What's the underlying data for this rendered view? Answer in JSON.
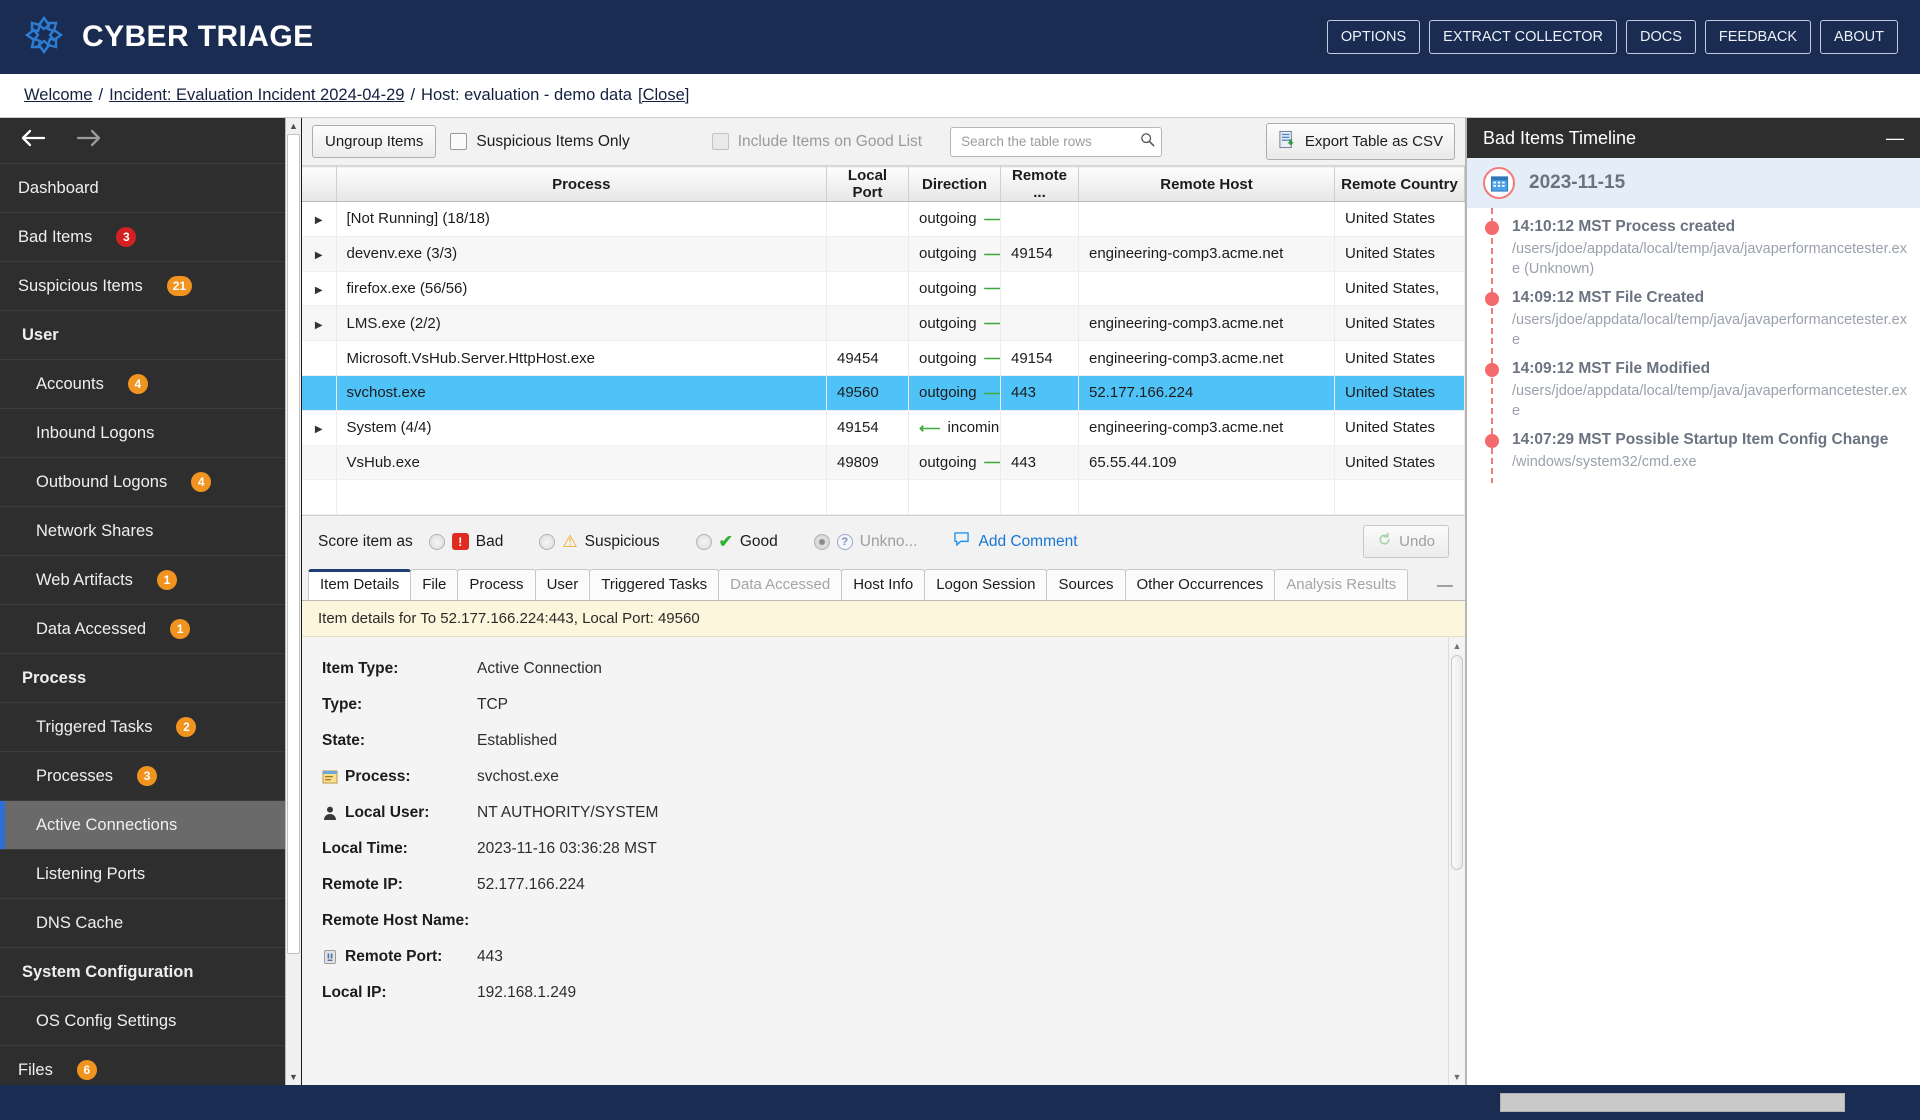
{
  "app": {
    "brand": "CYBER TRIAGE",
    "logo_icon": "cyber-triage-logo-icon",
    "top_buttons": [
      {
        "label": "OPTIONS",
        "name": "options-button"
      },
      {
        "label": "EXTRACT COLLECTOR",
        "name": "extract-collector-button"
      },
      {
        "label": "DOCS",
        "name": "docs-button"
      },
      {
        "label": "FEEDBACK",
        "name": "feedback-button"
      },
      {
        "label": "ABOUT",
        "name": "about-button"
      }
    ]
  },
  "breadcrumb": {
    "welcome": "Welcome",
    "sep1": "/",
    "incident": "Incident: Evaluation Incident 2024-04-29",
    "sep2": "/",
    "host": "Host: evaluation - demo data",
    "close": "[Close]"
  },
  "sidebar": {
    "back_icon": "arrow-left-icon",
    "forward_icon": "arrow-right-icon",
    "items": [
      {
        "label": "Dashboard",
        "badge": "",
        "badge_color": "",
        "type": "item",
        "selected": false
      },
      {
        "label": "Bad Items",
        "badge": "3",
        "badge_color": "#d32020",
        "type": "item",
        "selected": false
      },
      {
        "label": "Suspicious Items",
        "badge": "21",
        "badge_color": "#f0941f",
        "type": "item",
        "selected": false
      },
      {
        "label": "User",
        "badge": "",
        "badge_color": "",
        "type": "group",
        "selected": false
      },
      {
        "label": "Accounts",
        "badge": "4",
        "badge_color": "#f0941f",
        "type": "sub",
        "selected": false
      },
      {
        "label": "Inbound Logons",
        "badge": "",
        "badge_color": "",
        "type": "sub",
        "selected": false
      },
      {
        "label": "Outbound Logons",
        "badge": "4",
        "badge_color": "#f0941f",
        "type": "sub",
        "selected": false
      },
      {
        "label": "Network Shares",
        "badge": "",
        "badge_color": "",
        "type": "sub",
        "selected": false
      },
      {
        "label": "Web Artifacts",
        "badge": "1",
        "badge_color": "#f0941f",
        "type": "sub",
        "selected": false
      },
      {
        "label": "Data Accessed",
        "badge": "1",
        "badge_color": "#f0941f",
        "type": "sub",
        "selected": false
      },
      {
        "label": "Process",
        "badge": "",
        "badge_color": "",
        "type": "group",
        "selected": false
      },
      {
        "label": "Triggered Tasks",
        "badge": "2",
        "badge_color": "#f0941f",
        "type": "sub",
        "selected": false
      },
      {
        "label": "Processes",
        "badge": "3",
        "badge_color": "#f0941f",
        "type": "sub",
        "selected": false
      },
      {
        "label": "Active Connections",
        "badge": "",
        "badge_color": "",
        "type": "sub",
        "selected": true
      },
      {
        "label": "Listening Ports",
        "badge": "",
        "badge_color": "",
        "type": "sub",
        "selected": false
      },
      {
        "label": "DNS Cache",
        "badge": "",
        "badge_color": "",
        "type": "sub",
        "selected": false
      },
      {
        "label": "System Configuration",
        "badge": "",
        "badge_color": "",
        "type": "group",
        "selected": false
      },
      {
        "label": "OS Config Settings",
        "badge": "",
        "badge_color": "",
        "type": "sub",
        "selected": false
      },
      {
        "label": "Files",
        "badge": "6",
        "badge_color": "#f0941f",
        "type": "item",
        "selected": false
      }
    ]
  },
  "toolbar": {
    "ungroup_label": "Ungroup Items",
    "suspicious_only_label": "Suspicious Items Only",
    "suspicious_only_checked": false,
    "good_list_label": "Include Items on Good List",
    "good_list_checked": false,
    "good_list_disabled": true,
    "search_placeholder": "Search the table rows",
    "search_value": "",
    "search_icon": "search-icon",
    "export_label": "Export Table as CSV",
    "export_icon": "export-csv-icon"
  },
  "table": {
    "columns": [
      "Process",
      "Local Port",
      "Direction",
      "Remote ...",
      "Remote Host",
      "Remote Country"
    ],
    "rows": [
      {
        "expandable": true,
        "process": "[Not Running] (18/18)",
        "local_port": "",
        "direction": "outgoing",
        "dir_arrow": "right",
        "remote_port": "",
        "remote_host": "",
        "remote_country": "United States",
        "selected": false
      },
      {
        "expandable": true,
        "process": "devenv.exe (3/3)",
        "local_port": "",
        "direction": "outgoing",
        "dir_arrow": "right",
        "remote_port": "49154",
        "remote_host": "engineering-comp3.acme.net",
        "remote_country": "United States",
        "selected": false
      },
      {
        "expandable": true,
        "process": "firefox.exe (56/56)",
        "local_port": "",
        "direction": "outgoing",
        "dir_arrow": "right",
        "remote_port": "",
        "remote_host": "",
        "remote_country": "United States,",
        "selected": false
      },
      {
        "expandable": true,
        "process": "LMS.exe (2/2)",
        "local_port": "",
        "direction": "outgoing",
        "dir_arrow": "right",
        "remote_port": "",
        "remote_host": "engineering-comp3.acme.net",
        "remote_country": "United States",
        "selected": false
      },
      {
        "expandable": false,
        "process": "Microsoft.VsHub.Server.HttpHost.exe",
        "local_port": "49454",
        "direction": "outgoing",
        "dir_arrow": "right",
        "remote_port": "49154",
        "remote_host": "engineering-comp3.acme.net",
        "remote_country": "United States",
        "selected": false
      },
      {
        "expandable": false,
        "process": "svchost.exe",
        "local_port": "49560",
        "direction": "outgoing",
        "dir_arrow": "right",
        "remote_port": "443",
        "remote_host": "52.177.166.224",
        "remote_country": "United States",
        "selected": true
      },
      {
        "expandable": true,
        "process": "System (4/4)",
        "local_port": "49154",
        "direction": "incoming",
        "dir_arrow": "left",
        "remote_port": "",
        "remote_host": "engineering-comp3.acme.net",
        "remote_country": "United States",
        "selected": false
      },
      {
        "expandable": false,
        "process": "VsHub.exe",
        "local_port": "49809",
        "direction": "outgoing",
        "dir_arrow": "right",
        "remote_port": "443",
        "remote_host": "65.55.44.109",
        "remote_country": "United States",
        "selected": false
      }
    ]
  },
  "score_bar": {
    "prompt": "Score item as",
    "bad_label": "Bad",
    "suspicious_label": "Suspicious",
    "good_label": "Good",
    "unknown_label": "Unkno...",
    "selected": "unknown",
    "add_comment_label": "Add Comment",
    "comment_icon": "comment-icon",
    "undo_label": "Undo",
    "undo_icon": "undo-icon"
  },
  "detail_tabs": {
    "tabs": [
      {
        "label": "Item Details",
        "active": true,
        "disabled": false
      },
      {
        "label": "File",
        "active": false,
        "disabled": false
      },
      {
        "label": "Process",
        "active": false,
        "disabled": false
      },
      {
        "label": "User",
        "active": false,
        "disabled": false
      },
      {
        "label": "Triggered Tasks",
        "active": false,
        "disabled": false
      },
      {
        "label": "Data Accessed",
        "active": false,
        "disabled": true
      },
      {
        "label": "Host Info",
        "active": false,
        "disabled": false
      },
      {
        "label": "Logon Session",
        "active": false,
        "disabled": false
      },
      {
        "label": "Sources",
        "active": false,
        "disabled": false
      },
      {
        "label": "Other Occurrences",
        "active": false,
        "disabled": false
      },
      {
        "label": "Analysis Results",
        "active": false,
        "disabled": true
      }
    ],
    "minimize_icon": "minimize-icon"
  },
  "detail": {
    "banner": "Item details for To 52.177.166.224:443, Local Port: 49560",
    "fields": [
      {
        "label": "Item Type:",
        "value": "Active Connection",
        "icon": ""
      },
      {
        "label": "Type:",
        "value": "TCP",
        "icon": ""
      },
      {
        "label": "State:",
        "value": "Established",
        "icon": ""
      },
      {
        "label": "Process:",
        "value": "svchost.exe",
        "icon": "process-icon"
      },
      {
        "label": "Local User:",
        "value": "NT AUTHORITY/SYSTEM",
        "icon": "user-icon"
      },
      {
        "label": "Local Time:",
        "value": "2023-11-16 03:36:28 MST",
        "icon": ""
      },
      {
        "label": "Remote IP:",
        "value": "52.177.166.224",
        "icon": ""
      },
      {
        "label": "Remote Host Name:",
        "value": "",
        "icon": ""
      },
      {
        "label": "Remote Port:",
        "value": "443",
        "icon": "port-icon"
      },
      {
        "label": "Local IP:",
        "value": "192.168.1.249",
        "icon": ""
      }
    ]
  },
  "timeline": {
    "title": "Bad Items Timeline",
    "minimize_icon": "minimize-icon",
    "date": "2023-11-15",
    "calendar_icon": "calendar-icon",
    "events": [
      {
        "time_title": "14:10:12 MST Process created",
        "desc": "/users/jdoe/appdata/local/temp/java/javaperformancetester.exe (Unknown)"
      },
      {
        "time_title": "14:09:12 MST File Created",
        "desc": "/users/jdoe/appdata/local/temp/java/javaperformancetester.exe"
      },
      {
        "time_title": "14:09:12 MST File Modified",
        "desc": "/users/jdoe/appdata/local/temp/java/javaperformancetester.exe"
      },
      {
        "time_title": "14:07:29 MST Possible Startup Item Config Change",
        "desc": "/windows/system32/cmd.exe"
      }
    ]
  },
  "statusbar": {
    "progress_value": ""
  },
  "colors": {
    "brand_navy": "#1b2c52",
    "selection_blue": "#4fc3f7",
    "badge_orange": "#f0941f",
    "badge_red": "#d32020",
    "accent_blue": "#2d6fd6",
    "timeline_red": "#f4696b"
  }
}
